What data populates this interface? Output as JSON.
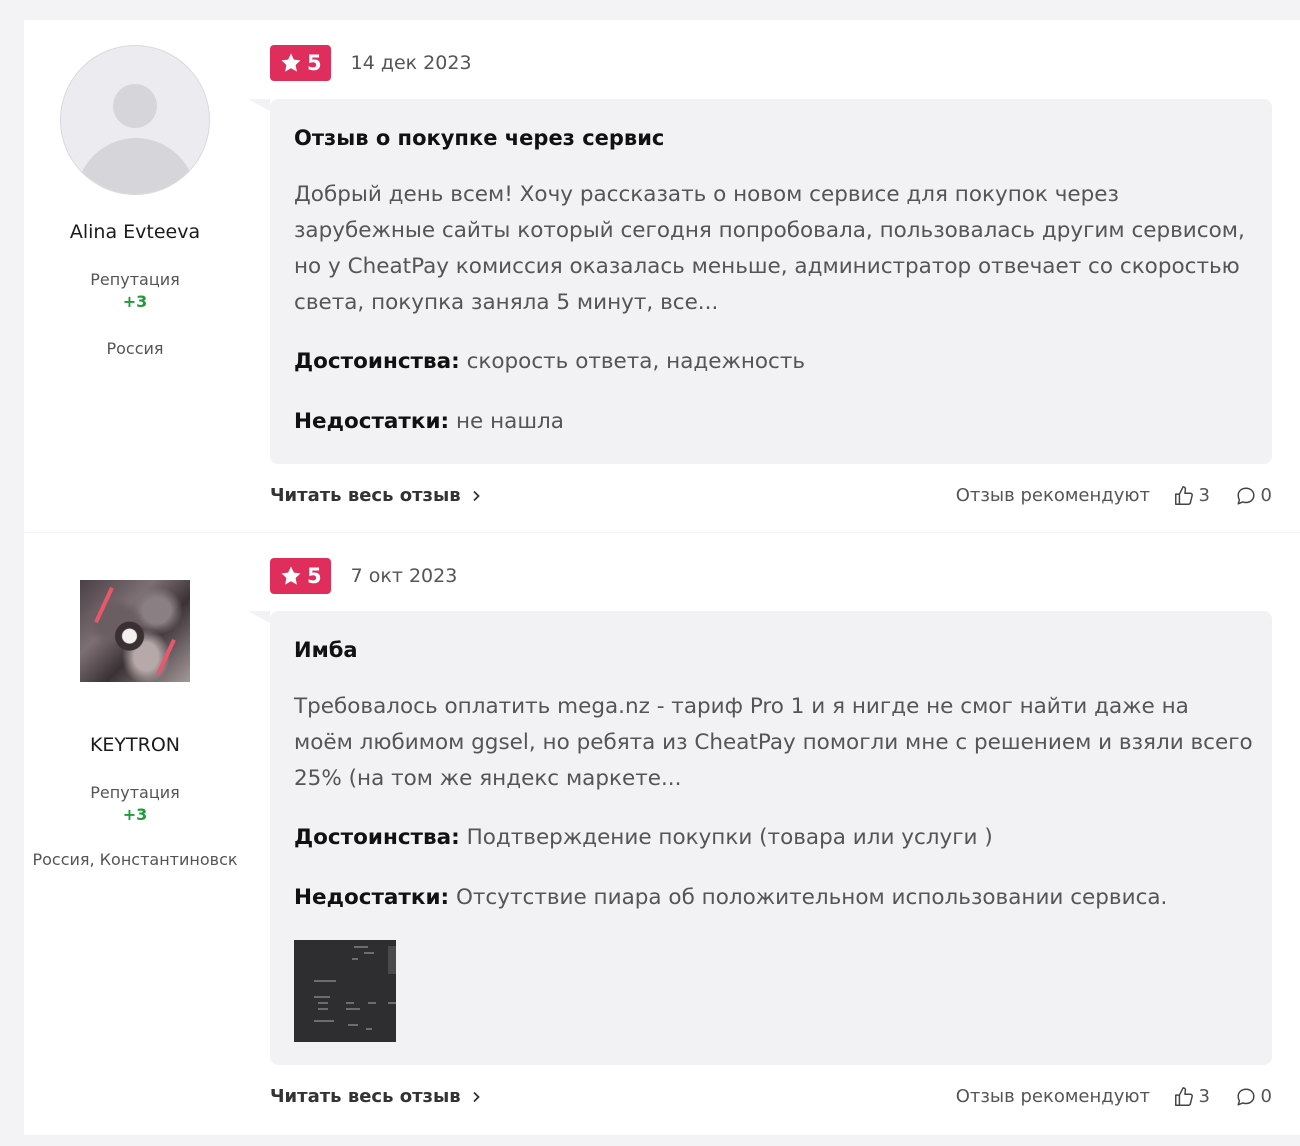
{
  "reviews": [
    {
      "author": {
        "name": "Alina Evteeva",
        "reputation_label": "Репутация",
        "reputation_value": "+3",
        "location": "Россия"
      },
      "rating": "5",
      "date": "14 дек 2023",
      "title": "Отзыв о покупке через сервис",
      "text": "Добрый день всем! Хочу рассказать о новом сервисе для покупок через зарубежные сайты который сегодня попробовала, пользовалась другим сервисом, но у CheatPay комиссия оказалась меньше, администратор отвечает со скоростью света, покупка заняла 5 минут, все...",
      "pros_label": "Достоинства:",
      "pros": "скорость ответа, надежность",
      "cons_label": "Недостатки:",
      "cons": "не нашла",
      "read_more": "Читать весь отзыв",
      "recommend_label": "Отзыв рекомендуют",
      "likes": "3",
      "comments": "0"
    },
    {
      "author": {
        "name": "KEYTRON",
        "reputation_label": "Репутация",
        "reputation_value": "+3",
        "location": "Россия, Константиновск"
      },
      "rating": "5",
      "date": "7 окт 2023",
      "title": "Имба",
      "text": "Требовалось оплатить mega.nz - тариф Pro 1 и я нигде не смог найти даже на моём любимом ggsel, но ребята из CheatPay помогли мне с решением и взяли всего 25% (на том же яндекс маркете...",
      "pros_label": "Достоинства:",
      "pros": "Подтверждение покупки (товара или услуги )",
      "cons_label": "Недостатки:",
      "cons": "Отсутствие пиара об положительном использовании сервиса.",
      "read_more": "Читать весь отзыв",
      "recommend_label": "Отзыв рекомендуют",
      "likes": "3",
      "comments": "0"
    }
  ],
  "colors": {
    "rating_badge": "#e02e5c",
    "reputation": "#1e9c3a",
    "card_bg": "#f2f2f4",
    "page_bg": "#f3f3f5"
  },
  "icons": {
    "rating": "star-icon",
    "read_more": "chevron-right-icon",
    "likes": "thumbs-up-icon",
    "comments": "comment-icon"
  }
}
